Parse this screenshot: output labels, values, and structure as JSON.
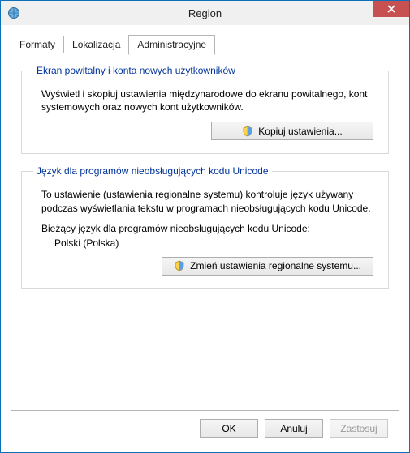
{
  "window": {
    "title": "Region"
  },
  "tabs": {
    "items": [
      {
        "label": "Formaty"
      },
      {
        "label": "Lokalizacja"
      },
      {
        "label": "Administracyjne"
      }
    ],
    "activeIndex": 2
  },
  "group_welcome": {
    "legend": "Ekran powitalny i konta nowych użytkowników",
    "description": "Wyświetl i skopiuj ustawienia międzynarodowe do ekranu powitalnego, kont systemowych oraz nowych kont użytkowników.",
    "button": "Kopiuj ustawienia..."
  },
  "group_unicode": {
    "legend": "Język dla programów nieobsługujących kodu Unicode",
    "description": "To ustawienie (ustawienia regionalne systemu) kontroluje język używany podczas wyświetlania tekstu w programach nieobsługujących kodu Unicode.",
    "current_label": "Bieżący język dla programów nieobsługujących kodu Unicode:",
    "current_value": "Polski (Polska)",
    "button": "Zmień ustawienia regionalne systemu..."
  },
  "footer": {
    "ok": "OK",
    "cancel": "Anuluj",
    "apply": "Zastosuj"
  }
}
